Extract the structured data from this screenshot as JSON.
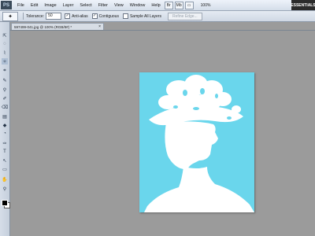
{
  "app": {
    "logo": "PS"
  },
  "menu": [
    "File",
    "Edit",
    "Image",
    "Layer",
    "Select",
    "Filter",
    "View",
    "Window",
    "Help"
  ],
  "mini_buttons": [
    "Br",
    "Mb",
    "▭"
  ],
  "zoom_level": "100%",
  "workspace": "ESSENTIALS",
  "options": {
    "tolerance_label": "Tolerance:",
    "tolerance_value": "50",
    "anti_alias_label": "Anti-alias",
    "contiguous_label": "Contiguous",
    "sample_all_layers_label": "Sample All Layers",
    "refine_edge_label": "Refine Edge..."
  },
  "document": {
    "tab_title": "597499-041.jpg @ 100% (RGB/8#) *",
    "close_label": "×"
  },
  "tools": [
    "⇱",
    "◌",
    "⌇",
    "✧",
    "⌗",
    "✎",
    "⚲",
    "✐",
    "⌫",
    "▤",
    "◆",
    "◔",
    "✑",
    "T",
    "↖",
    "▭",
    "✋",
    "⚲"
  ],
  "colors": {
    "canvas_bg": "#6ad6ec",
    "silhouette": "#ffffff",
    "workspace_bg": "#9b9b9b"
  }
}
